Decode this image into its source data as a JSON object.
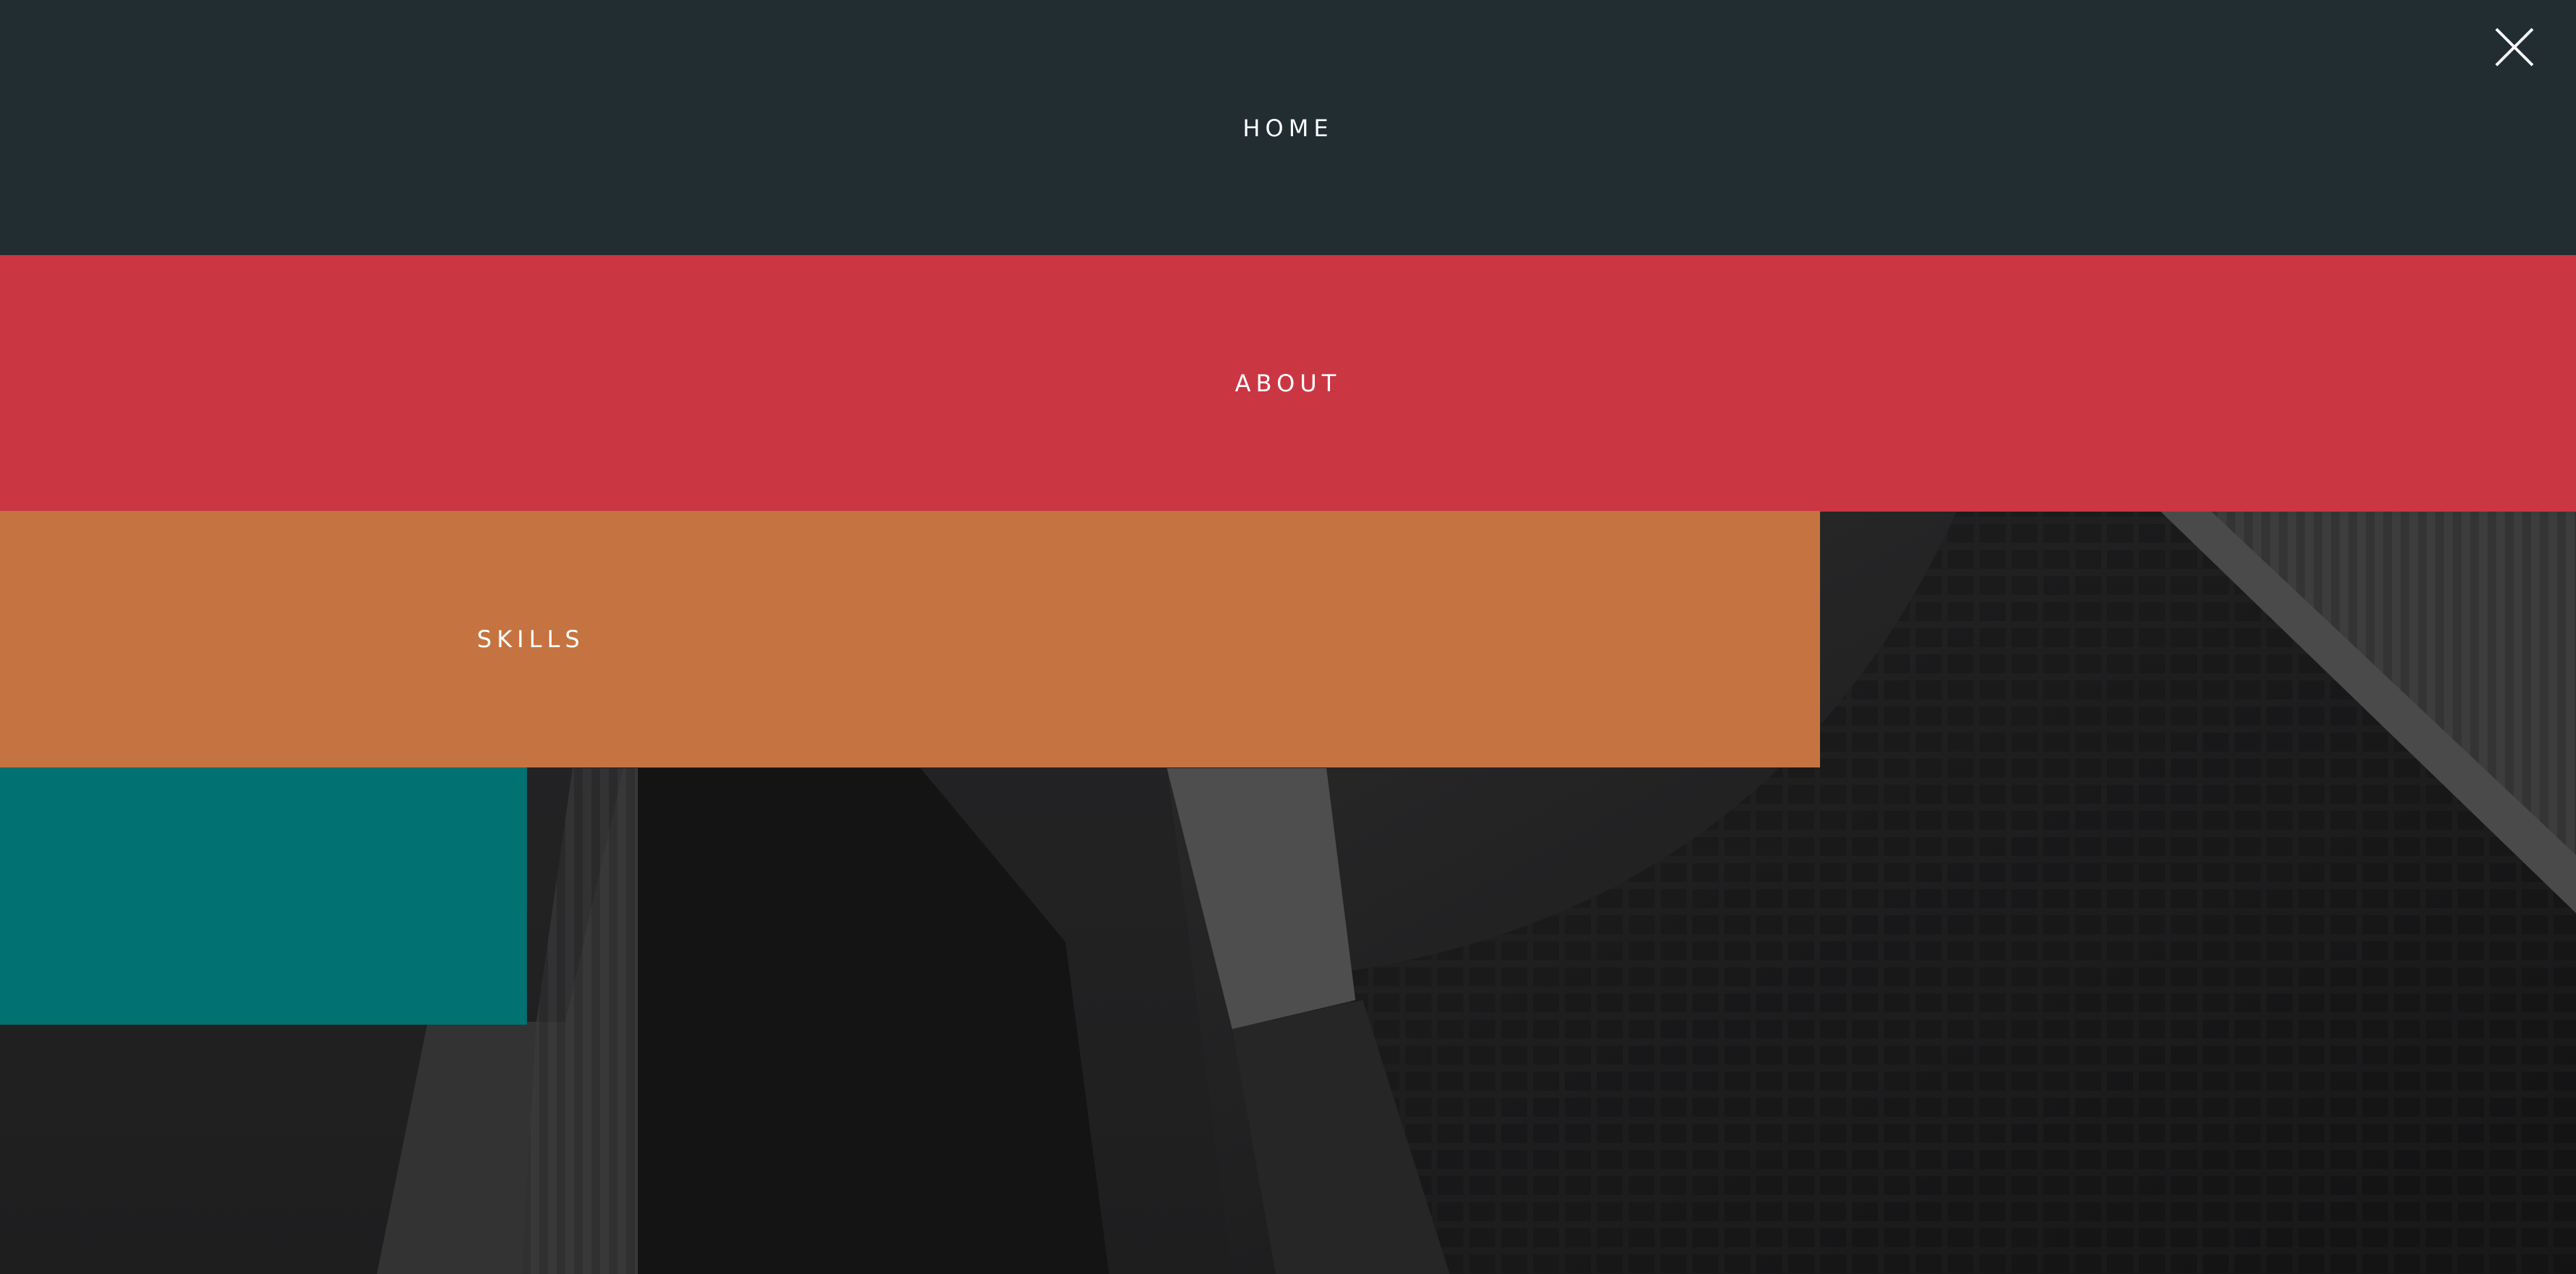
{
  "menu": {
    "items": [
      {
        "label": "HOME",
        "color": "#222d31"
      },
      {
        "label": "ABOUT",
        "color": "#cb3643"
      },
      {
        "label": "SKILLS",
        "color": "#c57441"
      },
      {
        "label": "",
        "color": "#017171"
      }
    ]
  },
  "close_icon": "close-icon",
  "background_image": "grayscale-buildings-photo"
}
